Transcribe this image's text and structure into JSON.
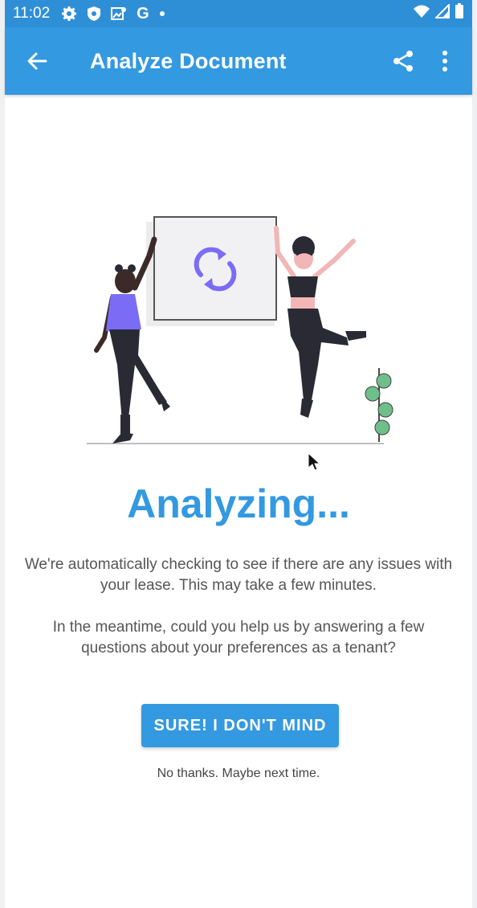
{
  "status_bar": {
    "time": "11:02",
    "left_icons": [
      "gear-icon",
      "shield-icon",
      "photo-icon",
      "g-icon",
      "dot-icon"
    ],
    "right_icons": [
      "wifi-icon",
      "signal-icon",
      "battery-icon"
    ],
    "g_label": "G"
  },
  "app_bar": {
    "title": "Analyze Document",
    "color": "#3399e0"
  },
  "main": {
    "heading": "Analyzing...",
    "paragraph1": "We're automatically checking to see if there are any issues with your lease. This may take a few minutes.",
    "paragraph2": "In the meantime, could you help us by answering a few questions about your preferences as a tenant?",
    "cta_label": "SURE! I DON'T MIND",
    "decline_label": "No thanks. Maybe next time."
  },
  "colors": {
    "accent": "#3399e0",
    "illustration_accent": "#7b6cf6",
    "plant": "#6fbf8a"
  }
}
